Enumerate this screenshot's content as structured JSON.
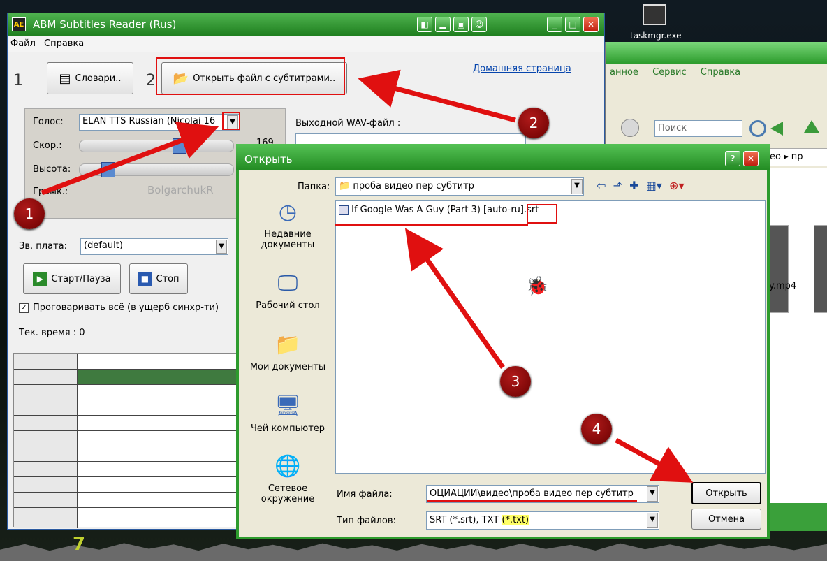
{
  "desktop": {
    "taskmgr_label": "taskmgr.exe"
  },
  "explorer": {
    "menu": [
      "анное",
      "Сервис",
      "Справка"
    ],
    "search_placeholder": "Поиск",
    "address_tail": "део  ▸  пр",
    "file_label": "y.mp4"
  },
  "abm": {
    "title": "ABM Subtitles Reader (Rus)",
    "menu": {
      "file": "Файл",
      "help": "Справка"
    },
    "step1": "1",
    "step2": "2",
    "dict_button": "Словари..",
    "open_button": "Открыть файл с субтитрами..",
    "home_link": "Домашняя страница",
    "voice_label": "Голос:",
    "voice_value": "ELAN TTS Russian (Nicolai 16",
    "speed_label": "Скор.:",
    "speed_value": "169",
    "pitch_label": "Высота:",
    "volume_label": "Громк.:",
    "watermark": "BolgarchukR",
    "output_label": "Выходной WAV-файл :",
    "soundcard_label": "Зв. плата:",
    "soundcard_value": "(default)",
    "start_button": "Старт/Пауза",
    "stop_button": "Стоп",
    "speak_all_label": "Проговаривать всё (в ущерб синхр-ти)",
    "current_time": "Тек. время : 0"
  },
  "dialog": {
    "title": "Открыть",
    "folder_label": "Папка:",
    "folder_value": "проба видео пер субтитр",
    "places": [
      {
        "label": "Недавние документы",
        "icon": "recent-docs-icon"
      },
      {
        "label": "Рабочий стол",
        "icon": "desktop-icon"
      },
      {
        "label": "Мои документы",
        "icon": "my-documents-icon"
      },
      {
        "label": "Чей компьютер",
        "icon": "my-computer-icon"
      },
      {
        "label": "Сетевое окружение",
        "icon": "network-icon"
      }
    ],
    "file_item": "If Google Was A Guy (Part 3) [auto-ru].srt",
    "filename_label": "Имя файла:",
    "filename_value": "ОЦИАЦИИ\\видео\\проба видео пер субтитр",
    "filetype_label": "Тип файлов:",
    "filetype_value_a": "SRT (*.srt), TXT ",
    "filetype_value_b": "(*.txt)",
    "open_button": "Открыть",
    "cancel_button": "Отмена"
  },
  "annotations": {
    "markers": [
      "1",
      "2",
      "3",
      "4"
    ],
    "color": "#e01010"
  }
}
